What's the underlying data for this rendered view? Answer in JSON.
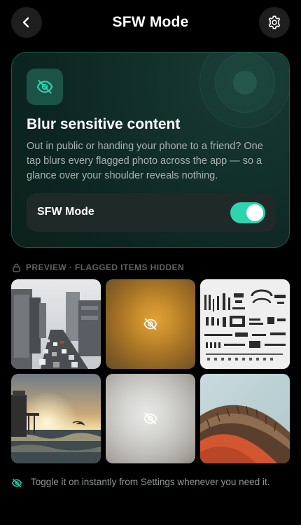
{
  "header": {
    "title": "SFW Mode",
    "back_icon": "chevron-left-icon",
    "settings_icon": "gear-icon"
  },
  "card": {
    "icon": "eye-off-icon",
    "title": "Blur sensitive content",
    "description": "Out in public or handing your phone to a friend? One tap blurs every flagged photo across the app — so a glance over your shoulder reveals nothing.",
    "toggle_label": "SFW Mode",
    "toggle_on": true,
    "accent_color": "#2ed3b0"
  },
  "preview": {
    "label": "PREVIEW · FLAGGED ITEMS HIDDEN",
    "lock_icon": "lock-icon",
    "tiles": [
      {
        "subject": "city-street-photo",
        "flagged": false
      },
      {
        "subject": "blurred-photo",
        "flagged": true,
        "icon": "eye-off-icon"
      },
      {
        "subject": "mechanical-parts-photo",
        "flagged": false
      },
      {
        "subject": "sunset-sea-photo",
        "flagged": false
      },
      {
        "subject": "blurred-photo",
        "flagged": true,
        "icon": "eye-off-icon"
      },
      {
        "subject": "architecture-photo",
        "flagged": false
      }
    ]
  },
  "footer": {
    "icon": "eye-off-icon",
    "text": "Toggle it on instantly from Settings whenever you need it."
  }
}
